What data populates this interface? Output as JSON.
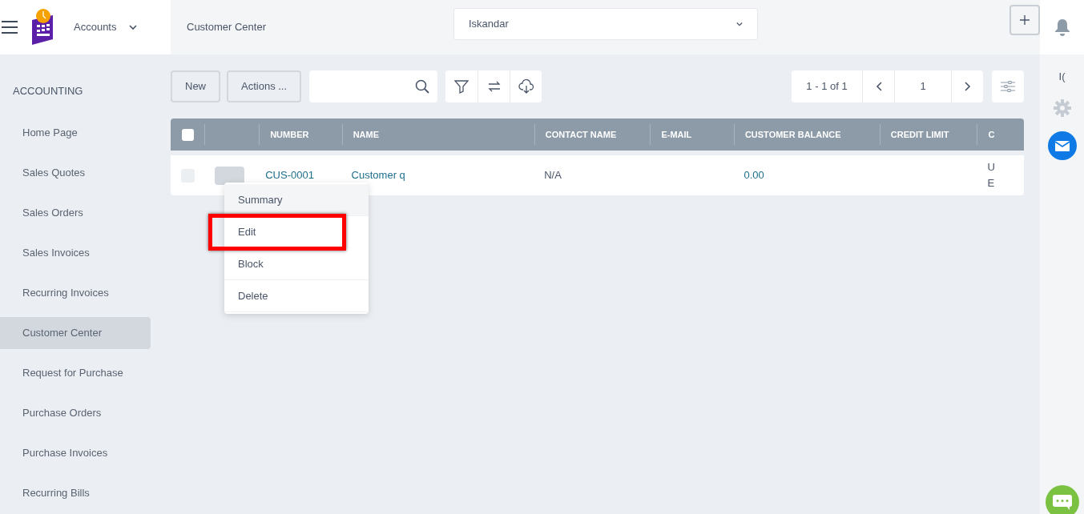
{
  "app": {
    "module": "Accounts",
    "page_title": "Customer Center",
    "company": "Iskandar"
  },
  "sidebar": {
    "heading": "ACCOUNTING",
    "items": [
      {
        "label": "Home Page",
        "selected": false
      },
      {
        "label": "Sales Quotes",
        "selected": false
      },
      {
        "label": "Sales Orders",
        "selected": false
      },
      {
        "label": "Sales Invoices",
        "selected": false
      },
      {
        "label": "Recurring Invoices",
        "selected": false
      },
      {
        "label": "Customer Center",
        "selected": true
      },
      {
        "label": "Request for Purchase",
        "selected": false
      },
      {
        "label": "Purchase Orders",
        "selected": false
      },
      {
        "label": "Purchase Invoices",
        "selected": false
      },
      {
        "label": "Recurring Bills",
        "selected": false
      }
    ]
  },
  "toolbar": {
    "buttons": [
      "New",
      "Actions ..."
    ],
    "pager": {
      "range": "1 - 1 of 1",
      "page": "1"
    }
  },
  "right_rail": {
    "label": "I("
  },
  "table": {
    "all_checked": false,
    "columns": [
      "NUMBER",
      "NAME",
      "CONTACT NAME",
      "E-MAIL",
      "CUSTOMER BALANCE",
      "CREDIT LIMIT",
      "C"
    ],
    "rows": [
      {
        "checked": false,
        "cells": [
          "CUS-0001",
          "Customer q",
          "N/A",
          "",
          "0.00",
          "",
          "U\nE"
        ]
      }
    ]
  },
  "context_menu": {
    "items": [
      {
        "label": "Summary",
        "selected": true,
        "highlighted": false
      },
      {
        "label": "Edit",
        "selected": false,
        "highlighted": true
      },
      {
        "label": "Block",
        "selected": false,
        "highlighted": false
      },
      {
        "label": "Delete",
        "selected": false,
        "highlighted": false
      }
    ]
  }
}
